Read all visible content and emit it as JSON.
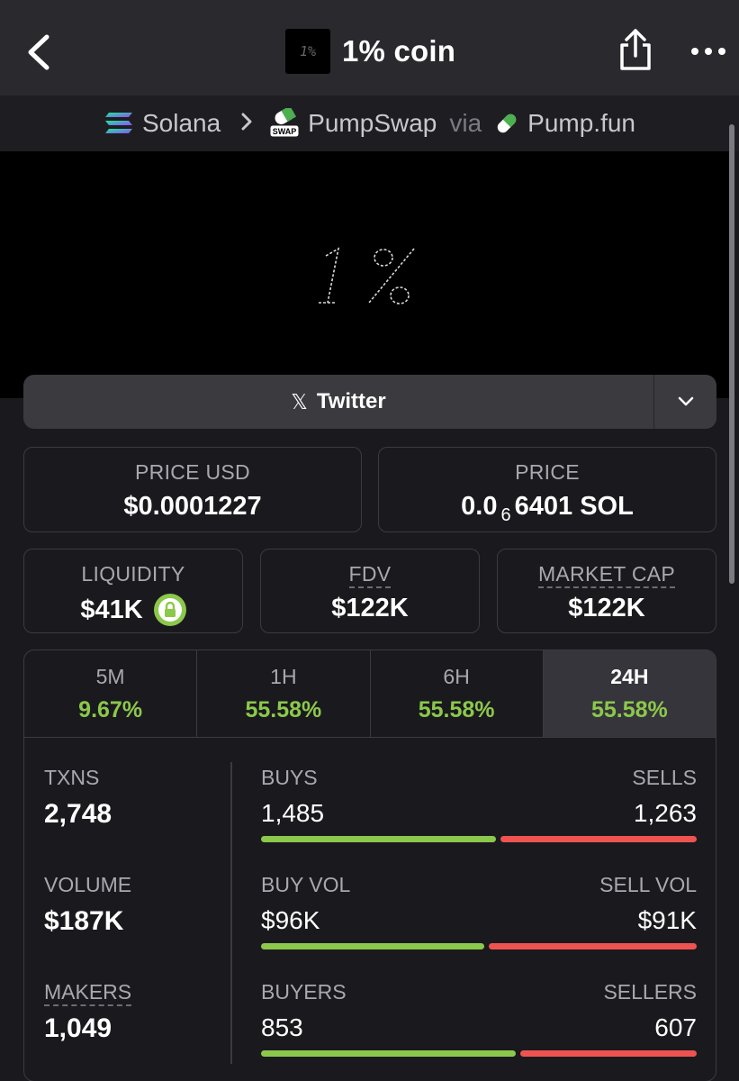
{
  "header": {
    "title": "1% coin",
    "logo_text": "1%"
  },
  "breadcrumb": {
    "chain": "Solana",
    "dex": "PumpSwap",
    "via": "via",
    "launchpad": "Pump.fun"
  },
  "banner": {
    "logo_text": "1%"
  },
  "twitter": {
    "label": "Twitter"
  },
  "stats": {
    "price_usd_label": "PRICE USD",
    "price_usd": "$0.0001227",
    "price_label": "PRICE",
    "price_prefix": "0.0",
    "price_zeros": "6",
    "price_suffix": "6401 SOL",
    "liquidity_label": "LIQUIDITY",
    "liquidity": "$41K",
    "fdv_label": "FDV",
    "fdv": "$122K",
    "mcap_label": "MARKET CAP",
    "mcap": "$122K"
  },
  "periods": [
    {
      "label": "5M",
      "change": "9.67%"
    },
    {
      "label": "1H",
      "change": "55.58%"
    },
    {
      "label": "6H",
      "change": "55.58%"
    },
    {
      "label": "24H",
      "change": "55.58%",
      "active": true
    }
  ],
  "activity": {
    "txns_label": "TXNS",
    "txns": "2,748",
    "volume_label": "VOLUME",
    "volume": "$187K",
    "makers_label": "MAKERS",
    "makers": "1,049",
    "buys_label": "BUYS",
    "buys": "1,485",
    "sells_label": "SELLS",
    "sells": "1,263",
    "buys_fraction": 0.54,
    "buyvol_label": "BUY VOL",
    "buyvol": "$96K",
    "sellvol_label": "SELL VOL",
    "sellvol": "$91K",
    "buyvol_fraction": 0.513,
    "buyers_label": "BUYERS",
    "buyers": "853",
    "sellers_label": "SELLERS",
    "sellers": "607",
    "buyers_fraction": 0.584
  },
  "colors": {
    "positive": "#8cc84b",
    "negative": "#ef5350",
    "background": "#1a1a1e"
  }
}
